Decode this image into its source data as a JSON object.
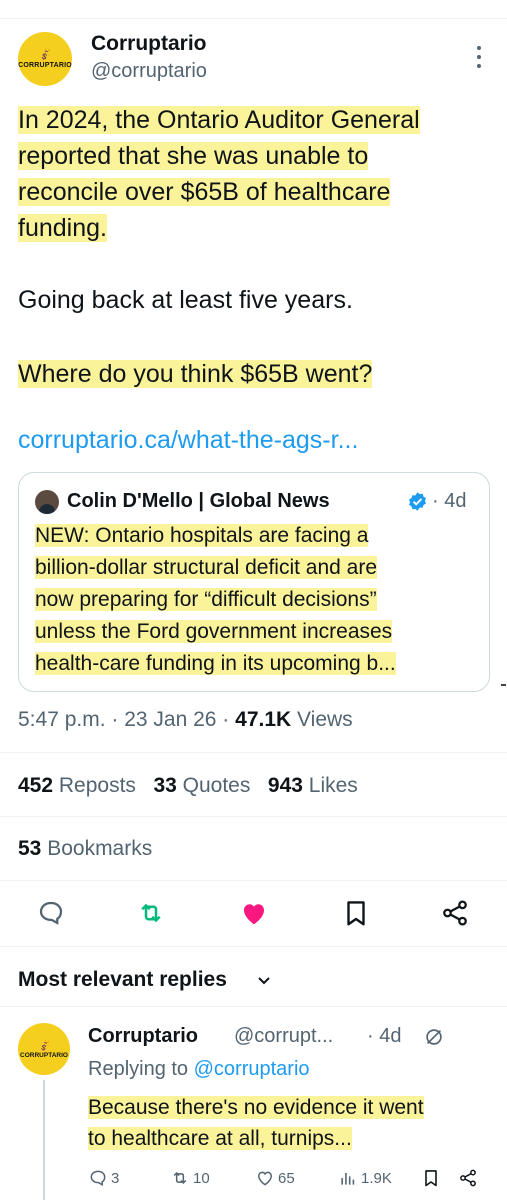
{
  "tweet": {
    "author_name": "Corruptario",
    "author_handle": "@corruptario",
    "avatar_brand": "CORRUPTARIO",
    "avatar_tagline": "CORRUPTARIO",
    "avatar_caption": "CORRUPTARIO",
    "body_lines": [
      "In 2024, the Ontario Auditor General",
      "reported that she was unable to",
      "reconcile over $65B of healthcare",
      "funding.",
      "Going back at least five years.",
      "Where do you think $65B went?"
    ],
    "link_text": "corruptario.ca/what-the-ags-r...",
    "quote": {
      "author": "Colin D'Mello | Global News",
      "time": "· 4d",
      "lines": [
        "NEW: Ontario hospitals are facing a",
        "billion-dollar structural deficit and are",
        "now preparing for “difficult decisions”",
        "unless the Ford government increases",
        "health-care funding in its upcoming b..."
      ]
    },
    "timestamp": "5:47 p.m. · 23 Jan 26 ·",
    "views_count": "47.1K",
    "views_label": "Views",
    "reposts_count": "452",
    "reposts_label": "Reposts",
    "quotes_count": "33",
    "quotes_label": "Quotes",
    "likes_count": "943",
    "likes_label": "Likes",
    "bookmarks_count": "53",
    "bookmarks_label": "Bookmarks"
  },
  "replies_section": {
    "title": "Most relevant replies"
  },
  "reply": {
    "author_name": "Corruptario",
    "author_handle": "@corrupt...",
    "time": "· 4d",
    "replying_prefix": "Replying to",
    "replying_handle": "@corruptario",
    "lines": [
      "Because there's no evidence it went",
      "to healthcare at all, turnips..."
    ],
    "replies": "3",
    "reposts": "10",
    "likes": "65",
    "views": "1.9K"
  },
  "colors": {
    "accent": "#1d9bf0",
    "like": "#f91880",
    "repost": "#00ba7c",
    "highlight": "#fbf39a",
    "avatar_bg": "#f5cf1e"
  },
  "icons": [
    "more-icon",
    "verified-icon",
    "reply-icon",
    "repost-icon",
    "like-icon",
    "bookmark-icon",
    "share-icon",
    "chevron-down-icon",
    "hide-icon",
    "views-icon"
  ]
}
